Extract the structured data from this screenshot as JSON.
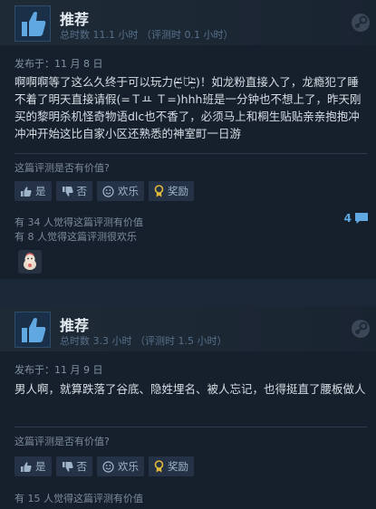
{
  "reviews": [
    {
      "recommendation": "推荐",
      "hours": "总时数 11.1 小时 （评测时 0.1 小时）",
      "posted": "发布于：11 月 8 日",
      "text": "啊啊啊等了这么久终于可以玩力(ᵔ̴̶̤᷄ꇴᵔ̴̶̤᷅)！如龙粉直接入了，龙瘾犯了睡不着了明天直接请假(=Ｔㅛ Ｔ=)hhh班是一分钟也不想上了，昨天刚买的黎明杀机怪奇物语dlc也不香了，必须马上和桐生贴贴亲亲抱抱冲冲冲开始这比自家小区还熟悉的神室町一日游",
      "helpful_question": "这篇评测是否有价值?",
      "buttons": {
        "yes": "是",
        "no": "否",
        "funny": "欢乐",
        "award": "奖励"
      },
      "helpful_count": "有 34 人觉得这篇评测有价值",
      "funny_count": "有 8 人觉得这篇评测很欢乐",
      "comment_count": "4"
    },
    {
      "recommendation": "推荐",
      "hours": "总时数 3.3 小时 （评测时 1.5 小时）",
      "posted": "发布于：11 月 9 日",
      "text": "男人啊，就算跌落了谷底、隐姓埋名、被人忘记，也得挺直了腰板做人",
      "helpful_question": "这篇评测是否有价值?",
      "buttons": {
        "yes": "是",
        "no": "否",
        "funny": "欢乐",
        "award": "奖励"
      },
      "helpful_count": "有 15 人觉得这篇评测有价值"
    }
  ],
  "colors": {
    "background": "#1b2838",
    "card": "#16202d",
    "thumb": "#5fa8e2",
    "award": "#e0b93a"
  },
  "icons": [
    "thumbs-up-icon",
    "thumbs-down-icon",
    "smiley-icon",
    "award-ribbon-icon",
    "steam-logo-icon",
    "comment-bubble-icon",
    "award-badge-icon"
  ]
}
